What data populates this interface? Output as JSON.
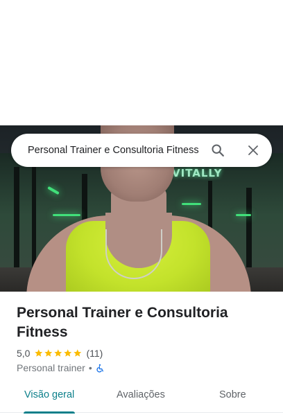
{
  "search": {
    "query": "Personal Trainer e Consultoria Fitness",
    "search_icon": "search-icon",
    "close_icon": "close-icon"
  },
  "photo": {
    "sign_text": "VITALLY"
  },
  "place": {
    "title": "Personal Trainer e Consultoria Fitness",
    "rating": "5,0",
    "stars": 5,
    "review_count": "(11)",
    "category": "Personal trainer",
    "separator": "•",
    "accessibility_icon": "wheelchair-icon"
  },
  "tabs": [
    {
      "label": "Visão geral",
      "active": true
    },
    {
      "label": "Avaliações",
      "active": false
    },
    {
      "label": "Sobre",
      "active": false
    }
  ],
  "colors": {
    "accent": "#0b7f8a",
    "star": "#fbbc04",
    "accessibility_blue": "#1a73e8"
  }
}
